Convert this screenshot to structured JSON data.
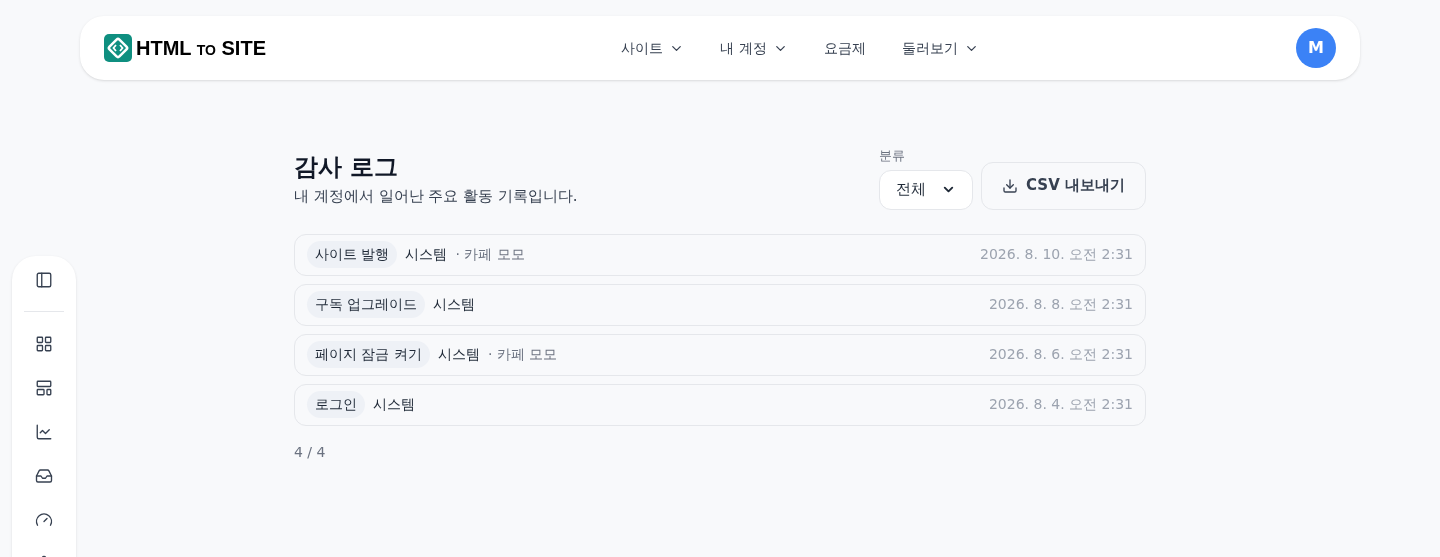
{
  "header": {
    "logo": {
      "main": "HTML",
      "small": "TO",
      "tail": "SITE"
    },
    "nav": [
      {
        "label": "사이트",
        "dropdown": true
      },
      {
        "label": "내 계정",
        "dropdown": true
      },
      {
        "label": "요금제",
        "dropdown": false
      },
      {
        "label": "둘러보기",
        "dropdown": true
      }
    ],
    "avatar": "M"
  },
  "page": {
    "title": "감사 로그",
    "subtitle": "내 계정에서 일어난 주요 활동 기록입니다.",
    "filter": {
      "label": "분류",
      "value": "전체"
    },
    "export_button": "CSV 내보내기",
    "entries": [
      {
        "action": "사이트 발행",
        "actor": "시스템",
        "target": "· 카페 모모",
        "time": "2026. 8. 10. 오전 2:31"
      },
      {
        "action": "구독 업그레이드",
        "actor": "시스템",
        "time": "2026. 8. 8. 오전 2:31"
      },
      {
        "action": "페이지 잠금 켜기",
        "actor": "시스템",
        "target": "· 카페 모모",
        "time": "2026. 8. 6. 오전 2:31"
      },
      {
        "action": "로그인",
        "actor": "시스템",
        "time": "2026. 8. 4. 오전 2:31"
      }
    ],
    "count": "4 / 4"
  }
}
